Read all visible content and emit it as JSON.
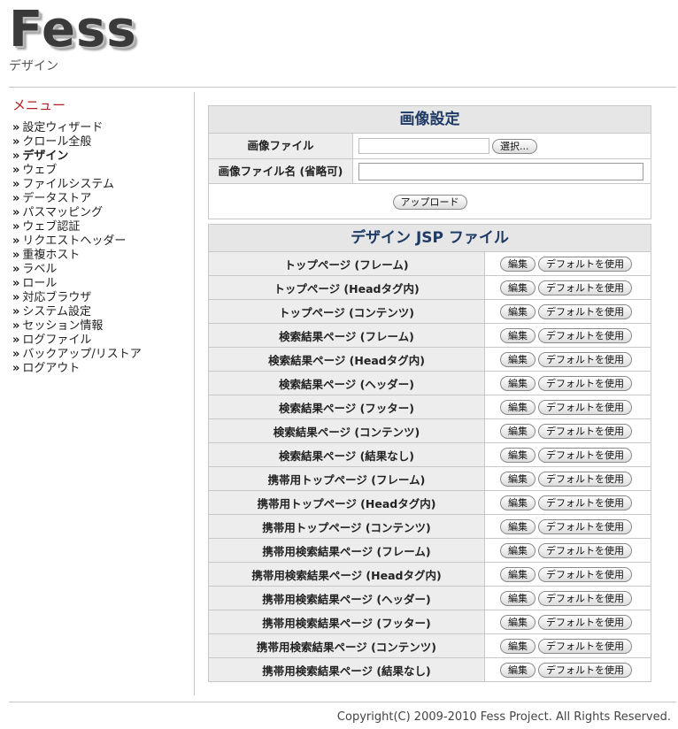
{
  "header": {
    "logo": "Fess",
    "subtitle": "デザイン"
  },
  "sidebar": {
    "title": "メニュー",
    "items": [
      {
        "label": "設定ウィザード",
        "active": false
      },
      {
        "label": "クロール全般",
        "active": false
      },
      {
        "label": "デザイン",
        "active": true
      },
      {
        "label": "ウェブ",
        "active": false
      },
      {
        "label": "ファイルシステム",
        "active": false
      },
      {
        "label": "データストア",
        "active": false
      },
      {
        "label": "パスマッピング",
        "active": false
      },
      {
        "label": "ウェブ認証",
        "active": false
      },
      {
        "label": "リクエストヘッダー",
        "active": false
      },
      {
        "label": "重複ホスト",
        "active": false
      },
      {
        "label": "ラベル",
        "active": false
      },
      {
        "label": "ロール",
        "active": false
      },
      {
        "label": "対応ブラウザ",
        "active": false
      },
      {
        "label": "システム設定",
        "active": false
      },
      {
        "label": "セッション情報",
        "active": false
      },
      {
        "label": "ログファイル",
        "active": false
      },
      {
        "label": "バックアップ/リストア",
        "active": false
      },
      {
        "label": "ログアウト",
        "active": false
      }
    ]
  },
  "image_settings": {
    "title": "画像設定",
    "file_label": "画像ファイル",
    "file_value": "",
    "browse_button": "選択...",
    "name_label": "画像ファイル名 (省略可)",
    "name_value": "",
    "upload_button": "アップロード"
  },
  "jsp_files": {
    "title": "デザイン JSP ファイル",
    "edit_button": "編集",
    "default_button": "デフォルトを使用",
    "rows": [
      "トップページ (フレーム)",
      "トップページ (Headタグ内)",
      "トップページ (コンテンツ)",
      "検索結果ページ (フレーム)",
      "検索結果ページ (Headタグ内)",
      "検索結果ページ (ヘッダー)",
      "検索結果ページ (フッター)",
      "検索結果ページ (コンテンツ)",
      "検索結果ページ (結果なし)",
      "携帯用トップページ (フレーム)",
      "携帯用トップページ (Headタグ内)",
      "携帯用トップページ (コンテンツ)",
      "携帯用検索結果ページ (フレーム)",
      "携帯用検索結果ページ (Headタグ内)",
      "携帯用検索結果ページ (ヘッダー)",
      "携帯用検索結果ページ (フッター)",
      "携帯用検索結果ページ (コンテンツ)",
      "携帯用検索結果ページ (結果なし)"
    ]
  },
  "footer": {
    "copyright": "Copyright(C) 2009-2010 Fess Project. All Rights Reserved."
  },
  "colors": {
    "panel_title": "#1e3a66",
    "menu_title": "#b02020",
    "label_bg": "#ededed",
    "header_bg": "#e6e6e6"
  }
}
